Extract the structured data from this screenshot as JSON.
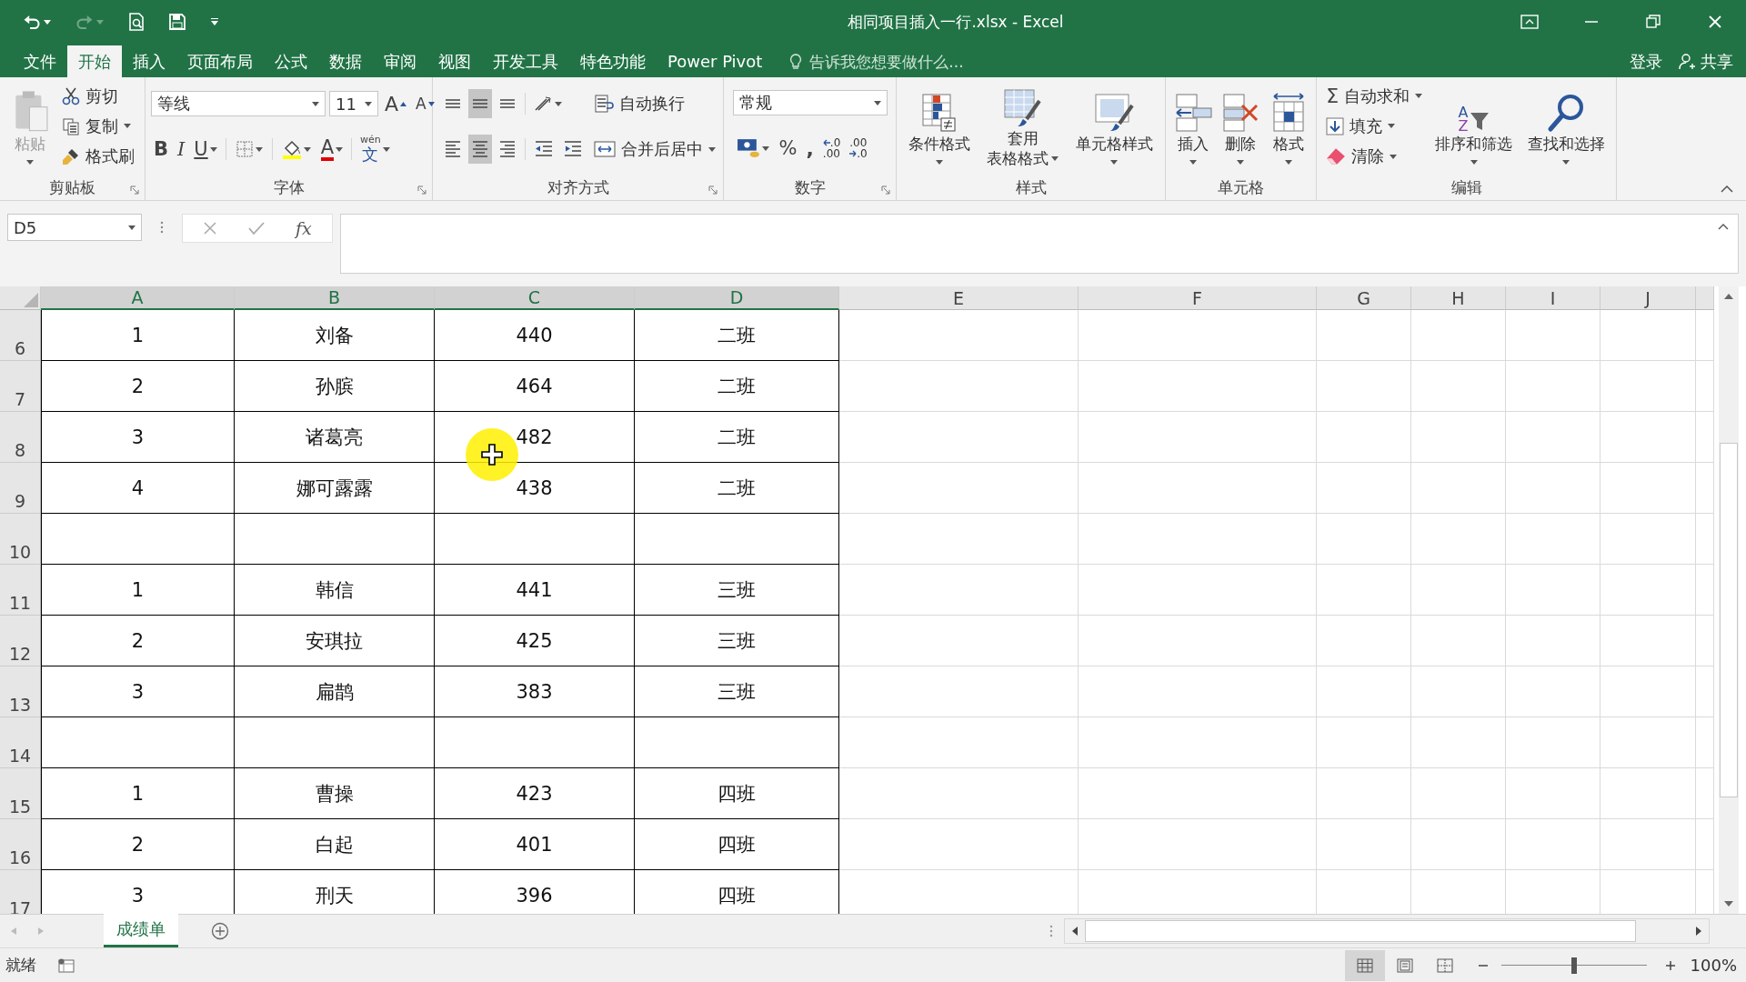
{
  "window": {
    "title": "相同项目插入一行.xlsx - Excel"
  },
  "quick_access": [
    {
      "kind": "undo",
      "disabled": false
    },
    {
      "kind": "redo",
      "disabled": true
    },
    {
      "kind": "preview",
      "disabled": false
    },
    {
      "kind": "save",
      "disabled": false
    },
    {
      "kind": "customize",
      "disabled": false
    }
  ],
  "ribbon_tabs": [
    {
      "label": "文件",
      "selected": false
    },
    {
      "label": "开始",
      "selected": true
    },
    {
      "label": "插入",
      "selected": false
    },
    {
      "label": "页面布局",
      "selected": false
    },
    {
      "label": "公式",
      "selected": false
    },
    {
      "label": "数据",
      "selected": false
    },
    {
      "label": "审阅",
      "selected": false
    },
    {
      "label": "视图",
      "selected": false
    },
    {
      "label": "开发工具",
      "selected": false
    },
    {
      "label": "特色功能",
      "selected": false
    },
    {
      "label": "Power Pivot",
      "selected": false
    }
  ],
  "tell_me": {
    "placeholder": "告诉我您想要做什么..."
  },
  "account": {
    "sign_in": "登录",
    "share": "共享"
  },
  "ribbon_groups": [
    {
      "label": "剪贴板",
      "launcher": true,
      "columns": [
        [
          [
            {
              "kind": "paste",
              "label": "粘贴",
              "disabled": true
            }
          ]
        ],
        [
          [
            {
              "kind": "cut",
              "label": "剪切"
            }
          ],
          [
            {
              "kind": "copy",
              "label": "复制"
            }
          ],
          [
            {
              "kind": "painter",
              "label": "格式刷"
            }
          ]
        ]
      ]
    },
    {
      "label": "字体",
      "launcher": true,
      "columns": [
        [
          [
            {
              "kind": "fontname",
              "value": "等线"
            },
            {
              "kind": "fontsize",
              "value": "11"
            },
            {
              "kind": "grow",
              "label": "A"
            },
            {
              "kind": "shrink",
              "label": "A"
            }
          ],
          [
            {
              "kind": "bold",
              "label": "B"
            },
            {
              "kind": "italic",
              "label": "I"
            },
            {
              "kind": "underline",
              "label": "U"
            },
            {
              "kind": "sep"
            },
            {
              "kind": "borders",
              "selected": false
            },
            {
              "kind": "sep"
            },
            {
              "kind": "fillcolor",
              "selected": false
            },
            {
              "kind": "fontcolor",
              "label": "A"
            },
            {
              "kind": "sep"
            },
            {
              "kind": "phonetic",
              "label": "文",
              "ruby": "wén"
            }
          ]
        ]
      ]
    },
    {
      "label": "对齐方式",
      "launcher": true,
      "columns": [
        [
          [
            {
              "kind": "aligntop",
              "selected": false
            },
            {
              "kind": "alignmiddle",
              "selected": true
            },
            {
              "kind": "alignbottom",
              "selected": false
            },
            {
              "kind": "sep"
            },
            {
              "kind": "orientation",
              "selected": false
            }
          ],
          [
            {
              "kind": "alignleft",
              "selected": false
            },
            {
              "kind": "aligncenter",
              "selected": true
            },
            {
              "kind": "alignright",
              "selected": false
            },
            {
              "kind": "sep"
            },
            {
              "kind": "outdent",
              "selected": false
            },
            {
              "kind": "indent",
              "selected": false
            }
          ]
        ],
        [
          [
            {
              "kind": "wrap",
              "label": "自动换行"
            }
          ],
          [
            {
              "kind": "merge",
              "label": "合并后居中"
            }
          ]
        ]
      ]
    },
    {
      "label": "数字",
      "launcher": true,
      "columns": [
        [
          [
            {
              "kind": "numberformat",
              "value": "常规"
            }
          ],
          [
            {
              "kind": "currency",
              "selected": false
            },
            {
              "kind": "percent",
              "label": "%"
            },
            {
              "kind": "comma",
              "label": ","
            },
            {
              "kind": "moredecimal",
              "top": ".0",
              "bottom": ".00"
            },
            {
              "kind": "lessdecimal",
              "top": ".00",
              "bottom": ".0"
            }
          ]
        ]
      ]
    },
    {
      "label": "样式",
      "launcher": false,
      "columns": [
        [
          [
            {
              "kind": "conditional",
              "label": "条件格式",
              "disabled": false
            }
          ]
        ],
        [
          [
            {
              "kind": "tableformat",
              "lines": [
                "套用",
                "表格格式"
              ],
              "disabled": false
            }
          ]
        ],
        [
          [
            {
              "kind": "cellstyle",
              "label": "单元格样式",
              "disabled": false
            }
          ]
        ]
      ]
    },
    {
      "label": "单元格",
      "launcher": false,
      "columns": [
        [
          [
            {
              "kind": "insert",
              "label": "插入",
              "disabled": false
            }
          ]
        ],
        [
          [
            {
              "kind": "delete",
              "label": "删除",
              "disabled": false
            }
          ]
        ],
        [
          [
            {
              "kind": "format",
              "label": "格式",
              "disabled": false
            }
          ]
        ]
      ]
    },
    {
      "label": "编辑",
      "launcher": false,
      "columns": [
        [
          [
            {
              "kind": "autosum",
              "symbol": "Σ",
              "label": "自动求和"
            }
          ],
          [
            {
              "kind": "filldown",
              "label": "填充"
            }
          ],
          [
            {
              "kind": "clear",
              "label": "清除"
            }
          ]
        ],
        [
          [
            {
              "kind": "sort",
              "letters": [
                "A",
                "Z"
              ],
              "label": "排序和筛选",
              "disabled": false
            }
          ]
        ],
        [
          [
            {
              "kind": "find",
              "label": "查找和选择",
              "disabled": false
            }
          ]
        ]
      ]
    }
  ],
  "formula_bar": {
    "name_box": "D5",
    "fx": "fx"
  },
  "columns": [
    {
      "label": "A",
      "selected": true
    },
    {
      "label": "B",
      "selected": true
    },
    {
      "label": "C",
      "selected": true
    },
    {
      "label": "D",
      "selected": true
    },
    {
      "label": "E",
      "selected": false
    },
    {
      "label": "F",
      "selected": false
    },
    {
      "label": "G",
      "selected": false
    },
    {
      "label": "H",
      "selected": false
    },
    {
      "label": "I",
      "selected": false
    },
    {
      "label": "J",
      "selected": false
    }
  ],
  "rows": [
    {
      "number": "6",
      "cells": [
        "1",
        "刘备",
        "440",
        "二班"
      ]
    },
    {
      "number": "7",
      "cells": [
        "2",
        "孙膑",
        "464",
        "二班"
      ]
    },
    {
      "number": "8",
      "cells": [
        "3",
        "诸葛亮",
        "482",
        "二班"
      ]
    },
    {
      "number": "9",
      "cells": [
        "4",
        "娜可露露",
        "438",
        "二班"
      ]
    },
    {
      "number": "10"
    },
    {
      "number": "11",
      "cells": [
        "1",
        "韩信",
        "441",
        "三班"
      ]
    },
    {
      "number": "12",
      "cells": [
        "2",
        "安琪拉",
        "425",
        "三班"
      ]
    },
    {
      "number": "13",
      "cells": [
        "3",
        "扁鹊",
        "383",
        "三班"
      ]
    },
    {
      "number": "14"
    },
    {
      "number": "15",
      "cells": [
        "1",
        "曹操",
        "423",
        "四班"
      ]
    },
    {
      "number": "16",
      "cells": [
        "2",
        "白起",
        "401",
        "四班"
      ]
    },
    {
      "number": "17",
      "cells": [
        "3",
        "刑天",
        "396",
        "四班"
      ]
    }
  ],
  "sheets": [
    {
      "label": "成绩单",
      "selected": true
    }
  ],
  "status_bar": {
    "text": "就绪",
    "views": [
      {
        "kind": "normal",
        "selected": true
      },
      {
        "kind": "layout",
        "selected": false
      },
      {
        "kind": "pagebreak",
        "selected": false
      }
    ],
    "zoom": {
      "level": 0.5,
      "reading": "100%"
    }
  }
}
